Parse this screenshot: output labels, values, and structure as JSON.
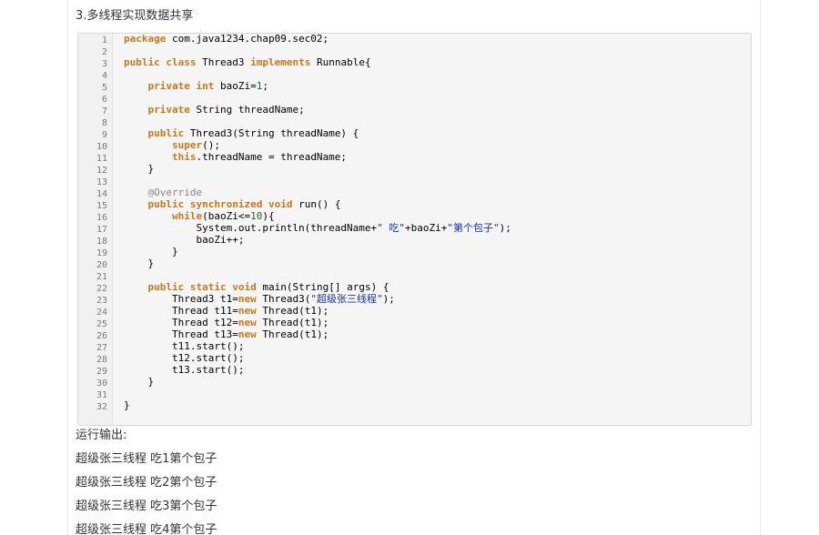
{
  "article": {
    "heading": "3.多线程实现数据共享",
    "line_numbers": [
      "1",
      "2",
      "3",
      "4",
      "5",
      "6",
      "7",
      "8",
      "9",
      "10",
      "11",
      "12",
      "13",
      "14",
      "15",
      "16",
      "17",
      "18",
      "19",
      "20",
      "21",
      "22",
      "23",
      "24",
      "25",
      "26",
      "27",
      "28",
      "29",
      "30",
      "31",
      "32"
    ],
    "code_lines": [
      [
        {
          "t": "package",
          "c": "kw"
        },
        {
          "t": " com.java1234.chap09.sec02;"
        }
      ],
      [],
      [
        {
          "t": "public",
          "c": "kw"
        },
        {
          "t": " "
        },
        {
          "t": "class",
          "c": "kw"
        },
        {
          "t": " Thread3 "
        },
        {
          "t": "implements",
          "c": "kw"
        },
        {
          "t": " Runnable{"
        }
      ],
      [],
      [
        {
          "t": "    "
        },
        {
          "t": "private",
          "c": "kw"
        },
        {
          "t": " "
        },
        {
          "t": "int",
          "c": "kw"
        },
        {
          "t": " baoZi="
        },
        {
          "t": "1",
          "c": "num"
        },
        {
          "t": ";"
        }
      ],
      [],
      [
        {
          "t": "    "
        },
        {
          "t": "private",
          "c": "kw"
        },
        {
          "t": " String threadName;"
        }
      ],
      [],
      [
        {
          "t": "    "
        },
        {
          "t": "public",
          "c": "kw"
        },
        {
          "t": " Thread3(String threadName) {"
        }
      ],
      [
        {
          "t": "        "
        },
        {
          "t": "super",
          "c": "kw"
        },
        {
          "t": "();"
        }
      ],
      [
        {
          "t": "        "
        },
        {
          "t": "this",
          "c": "kw"
        },
        {
          "t": ".threadName = threadName;"
        }
      ],
      [
        {
          "t": "    }"
        }
      ],
      [],
      [
        {
          "t": "    "
        },
        {
          "t": "@Override",
          "c": "ann"
        }
      ],
      [
        {
          "t": "    "
        },
        {
          "t": "public",
          "c": "kw"
        },
        {
          "t": " "
        },
        {
          "t": "synchronized",
          "c": "kw"
        },
        {
          "t": " "
        },
        {
          "t": "void",
          "c": "kw"
        },
        {
          "t": " run() {"
        }
      ],
      [
        {
          "t": "        "
        },
        {
          "t": "while",
          "c": "kw"
        },
        {
          "t": "(baoZi<="
        },
        {
          "t": "10",
          "c": "num"
        },
        {
          "t": "){"
        }
      ],
      [
        {
          "t": "            System.out.println(threadName+"
        },
        {
          "t": "\" 吃\"",
          "c": "str"
        },
        {
          "t": "+baoZi+"
        },
        {
          "t": "\"第个包子\"",
          "c": "str"
        },
        {
          "t": ");"
        }
      ],
      [
        {
          "t": "            baoZi++;"
        }
      ],
      [
        {
          "t": "        }"
        }
      ],
      [
        {
          "t": "    }"
        }
      ],
      [],
      [
        {
          "t": "    "
        },
        {
          "t": "public",
          "c": "kw"
        },
        {
          "t": " "
        },
        {
          "t": "static",
          "c": "kw"
        },
        {
          "t": " "
        },
        {
          "t": "void",
          "c": "kw"
        },
        {
          "t": " main(String[] args) {"
        }
      ],
      [
        {
          "t": "        Thread3 t1="
        },
        {
          "t": "new",
          "c": "kw"
        },
        {
          "t": " Thread3("
        },
        {
          "t": "\"超级张三线程\"",
          "c": "str"
        },
        {
          "t": ");"
        }
      ],
      [
        {
          "t": "        Thread t11="
        },
        {
          "t": "new",
          "c": "kw"
        },
        {
          "t": " Thread(t1);"
        }
      ],
      [
        {
          "t": "        Thread t12="
        },
        {
          "t": "new",
          "c": "kw"
        },
        {
          "t": " Thread(t1);"
        }
      ],
      [
        {
          "t": "        Thread t13="
        },
        {
          "t": "new",
          "c": "kw"
        },
        {
          "t": " Thread(t1);"
        }
      ],
      [
        {
          "t": "        t11.start();"
        }
      ],
      [
        {
          "t": "        t12.start();"
        }
      ],
      [
        {
          "t": "        t13.start();"
        }
      ],
      [
        {
          "t": "    }"
        }
      ],
      [],
      [
        {
          "t": "}"
        }
      ]
    ],
    "output_label": "运行输出:",
    "output_lines": [
      "超级张三线程 吃1第个包子",
      "超级张三线程 吃2第个包子",
      "超级张三线程 吃3第个包子",
      "超级张三线程 吃4第个包子"
    ]
  }
}
